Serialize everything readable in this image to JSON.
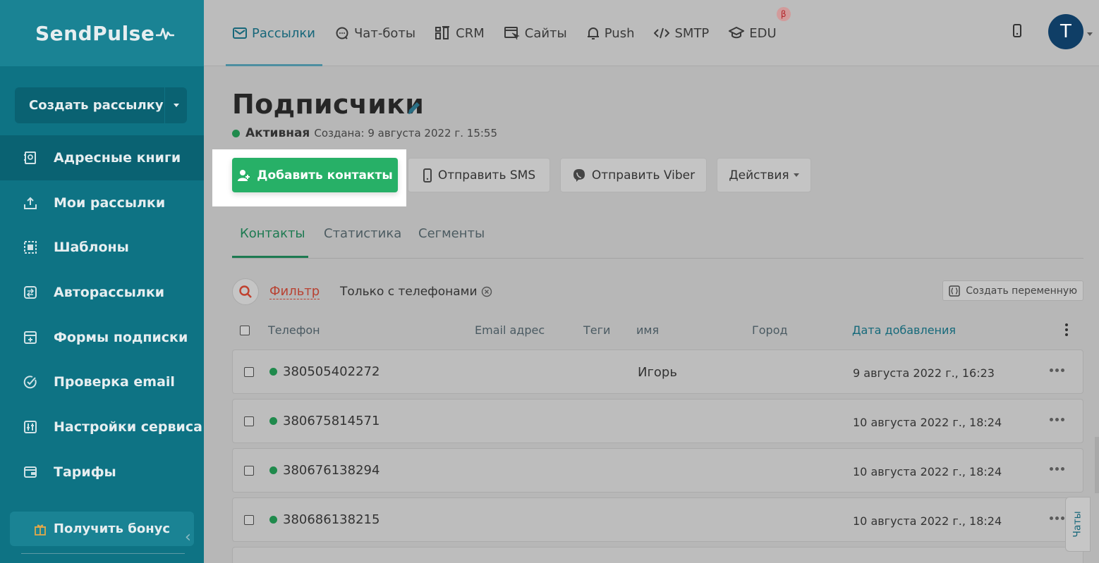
{
  "sidebar": {
    "logo": "SendPulse",
    "create_button": "Создать рассылку",
    "items": [
      {
        "label": "Адресные книги",
        "icon": "address-book-icon",
        "active": true
      },
      {
        "label": "Мои рассылки",
        "icon": "upload-icon",
        "active": false
      },
      {
        "label": "Шаблоны",
        "icon": "template-icon",
        "active": false
      },
      {
        "label": "Авторассылки",
        "icon": "automation-icon",
        "active": false
      },
      {
        "label": "Формы подписки",
        "icon": "form-icon",
        "active": false
      },
      {
        "label": "Проверка email",
        "icon": "check-icon",
        "active": false
      },
      {
        "label": "Настройки сервиса",
        "icon": "sliders-icon",
        "active": false
      },
      {
        "label": "Тарифы",
        "icon": "wallet-icon",
        "active": false
      }
    ],
    "bonus_button": "Получить бонус"
  },
  "topnav": {
    "items": [
      {
        "label": "Рассылки",
        "active": true
      },
      {
        "label": "Чат-боты",
        "active": false
      },
      {
        "label": "CRM",
        "active": false
      },
      {
        "label": "Сайты",
        "active": false
      },
      {
        "label": "Push",
        "active": false
      },
      {
        "label": "SMTP",
        "active": false
      },
      {
        "label": "EDU",
        "active": false,
        "badge": "β"
      }
    ],
    "avatar_letter": "T"
  },
  "page": {
    "title": "Подписчики",
    "status": "Активная",
    "created": "Создана: 9 августа 2022 г. 15:55"
  },
  "actions": {
    "add_contacts": "Добавить контакты",
    "send_sms": "Отправить SMS",
    "send_viber": "Отправить Viber",
    "actions": "Действия"
  },
  "tabs": [
    "Контакты",
    "Статистика",
    "Сегменты"
  ],
  "filter": {
    "label": "Фильтр",
    "chip": "Только с телефонами",
    "create_variable": "Создать переменную"
  },
  "table": {
    "headers": [
      "Телефон",
      "Email адрес",
      "Теги",
      "имя",
      "Город",
      "Дата добавления"
    ],
    "rows": [
      {
        "phone": "380505402272",
        "name": "Игорь",
        "date": "9 августа 2022 г., 16:23"
      },
      {
        "phone": "380675814571",
        "name": "",
        "date": "10 августа 2022 г., 18:24"
      },
      {
        "phone": "380676138294",
        "name": "",
        "date": "10 августа 2022 г., 18:24"
      },
      {
        "phone": "380686138215",
        "name": "",
        "date": "10 августа 2022 г., 18:24"
      }
    ]
  },
  "chats_tab": "Чаты",
  "colors": {
    "sidebar": "#0e7384",
    "accent_green": "#27b067",
    "filter_red": "#b84232",
    "avatar": "#0f3e66"
  }
}
